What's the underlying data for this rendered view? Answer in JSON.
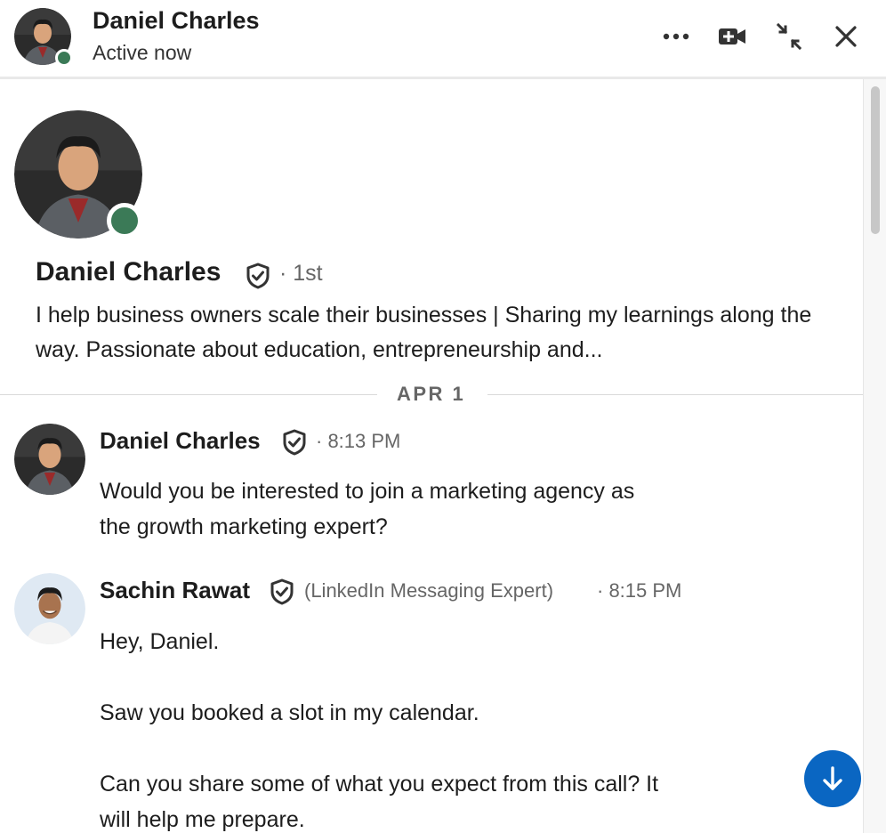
{
  "header": {
    "name": "Daniel Charles",
    "status": "Active now"
  },
  "profile": {
    "name": "Daniel Charles",
    "degree": "· 1st",
    "headline": "I help business owners scale their businesses | Sharing my learnings along the way. Passionate about education, entrepreneurship and..."
  },
  "date_divider": "APR 1",
  "messages": [
    {
      "sender": "Daniel Charles",
      "meta": "· 8:13 PM",
      "paragraphs": [
        "Would you be interested to join a marketing agency as",
        "the growth marketing expert?"
      ]
    },
    {
      "sender": "Sachin Rawat",
      "subtitle": "(LinkedIn Messaging Expert)",
      "meta": "· 8:15 PM",
      "paragraphs": [
        "Hey, Daniel.",
        "Saw you booked a slot in my calendar.",
        "Can you share some of what you expect from this call? It",
        "will help me prepare."
      ]
    }
  ],
  "colors": {
    "online": "#3b7a57",
    "accent": "#0a66c2"
  },
  "icons": [
    "more-options-icon",
    "video-call-icon",
    "minimize-icon",
    "close-icon",
    "verified-badge-icon",
    "arrow-down-icon"
  ]
}
